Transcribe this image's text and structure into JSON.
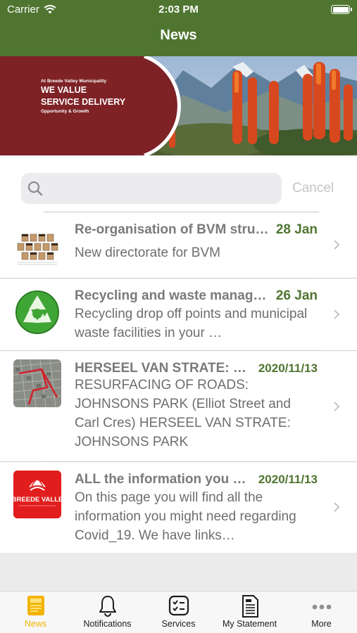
{
  "status_bar": {
    "carrier": "Carrier",
    "time": "2:03 PM"
  },
  "nav": {
    "title": "News"
  },
  "banner": {
    "line1": "At Breede Valley Municipality",
    "line2": "WE VALUE",
    "line3": "SERVICE DELIVERY",
    "line4": "Opportunity & Growth"
  },
  "search": {
    "placeholder": "",
    "cancel_label": "Cancel"
  },
  "news": [
    {
      "title": "Re-organisation of BVM structure",
      "date": "28 Jan",
      "summary": "New directorate for BVM",
      "thumb_icon": "faces-grid-icon"
    },
    {
      "title": "Recycling and waste management",
      "date": "26 Jan",
      "summary": "Recycling drop off points and municipal waste facilities in your …",
      "thumb_icon": "recycle-icon"
    },
    {
      "title": "HERSEEL VAN STRATE: JOHNSONS PARK",
      "date": "2020/11/13",
      "summary": "RESURFACING OF ROADS: JOHNSONS PARK (Elliot Street and Carl Cres)  HERSEEL VAN STRATE: JOHNSONS PARK",
      "thumb_icon": "road-map-icon"
    },
    {
      "title": "ALL the information you need",
      "date": "2020/11/13",
      "summary": "On this page you will find all the information you might need regarding Covid_19. We have links…",
      "thumb_icon": "breede-valley-logo-icon",
      "thumb_text": "BREEDE VALLE"
    }
  ],
  "tabs": [
    {
      "label": "News",
      "icon": "news-icon",
      "active": true
    },
    {
      "label": "Notifications",
      "icon": "bell-icon",
      "active": false
    },
    {
      "label": "Services",
      "icon": "checklist-icon",
      "active": false
    },
    {
      "label": "My Statement",
      "icon": "statement-icon",
      "active": false
    },
    {
      "label": "More",
      "icon": "ellipsis-icon",
      "active": false
    }
  ],
  "colors": {
    "nav_green": "#4f7530",
    "date_green": "#4f7530",
    "banner_red": "#7e2226",
    "tab_active": "#f2b400"
  }
}
